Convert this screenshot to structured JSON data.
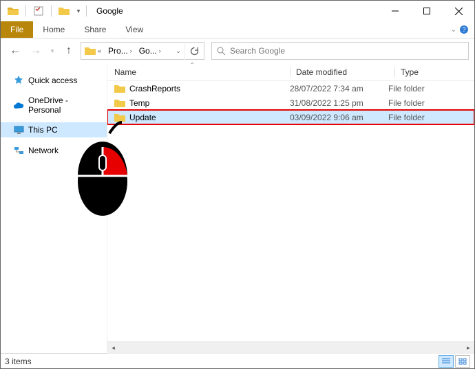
{
  "window": {
    "title": "Google"
  },
  "ribbon": {
    "file": "File",
    "tabs": [
      "Home",
      "Share",
      "View"
    ]
  },
  "address": {
    "segments": [
      "Pro...",
      "Go..."
    ],
    "search_placeholder": "Search Google"
  },
  "sidebar": {
    "items": [
      {
        "label": "Quick access",
        "icon": "star"
      },
      {
        "label": "OneDrive - Personal",
        "icon": "cloud"
      },
      {
        "label": "This PC",
        "icon": "pc",
        "selected": true
      },
      {
        "label": "Network",
        "icon": "network"
      }
    ]
  },
  "columns": {
    "name": "Name",
    "date": "Date modified",
    "type": "Type"
  },
  "rows": [
    {
      "name": "CrashReports",
      "date": "28/07/2022 7:34 am",
      "type": "File folder"
    },
    {
      "name": "Temp",
      "date": "31/08/2022 1:25 pm",
      "type": "File folder"
    },
    {
      "name": "Update",
      "date": "03/09/2022 9:06 am",
      "type": "File folder",
      "selected": true,
      "highlight": true
    }
  ],
  "status": {
    "text": "3 items"
  }
}
